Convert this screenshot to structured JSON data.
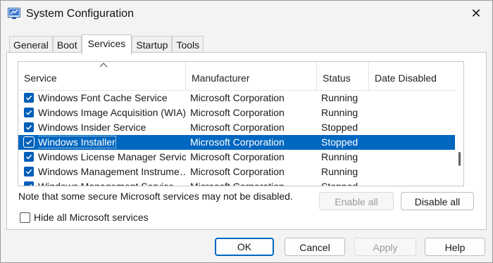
{
  "window": {
    "title": "System Configuration",
    "close_glyph": "✕"
  },
  "tabs": [
    {
      "label": "General"
    },
    {
      "label": "Boot"
    },
    {
      "label": "Services"
    },
    {
      "label": "Startup"
    },
    {
      "label": "Tools"
    }
  ],
  "services": {
    "columns": [
      "Service",
      "Manufacturer",
      "Status",
      "Date Disabled"
    ],
    "rows": [
      {
        "name": "Windows Font Cache Service",
        "manufacturer": "Microsoft Corporation",
        "status": "Running",
        "date_disabled": "",
        "checked": true
      },
      {
        "name": "Windows Image Acquisition (WIA)",
        "manufacturer": "Microsoft Corporation",
        "status": "Running",
        "date_disabled": "",
        "checked": true
      },
      {
        "name": "Windows Insider Service",
        "manufacturer": "Microsoft Corporation",
        "status": "Stopped",
        "date_disabled": "",
        "checked": true
      },
      {
        "name": "Windows Installer",
        "manufacturer": "Microsoft Corporation",
        "status": "Stopped",
        "date_disabled": "",
        "checked": true,
        "selected": true
      },
      {
        "name": "Windows License Manager Service",
        "manufacturer": "Microsoft Corporation",
        "status": "Running",
        "date_disabled": "",
        "checked": true
      },
      {
        "name": "Windows Management Instrume…",
        "manufacturer": "Microsoft Corporation",
        "status": "Running",
        "date_disabled": "",
        "checked": true
      },
      {
        "name": "Windows Management Service",
        "manufacturer": "Microsoft Corporation",
        "status": "Stopped",
        "date_disabled": "",
        "checked": true
      }
    ],
    "note": "Note that some secure Microsoft services may not be disabled.",
    "enable_all_label": "Enable all",
    "disable_all_label": "Disable all",
    "hide_ms_label": "Hide all Microsoft services",
    "hide_ms_checked": false
  },
  "footer": {
    "ok_label": "OK",
    "cancel_label": "Cancel",
    "apply_label": "Apply",
    "help_label": "Help"
  },
  "colors": {
    "accent": "#0067c0",
    "selection": "#0067c0"
  }
}
